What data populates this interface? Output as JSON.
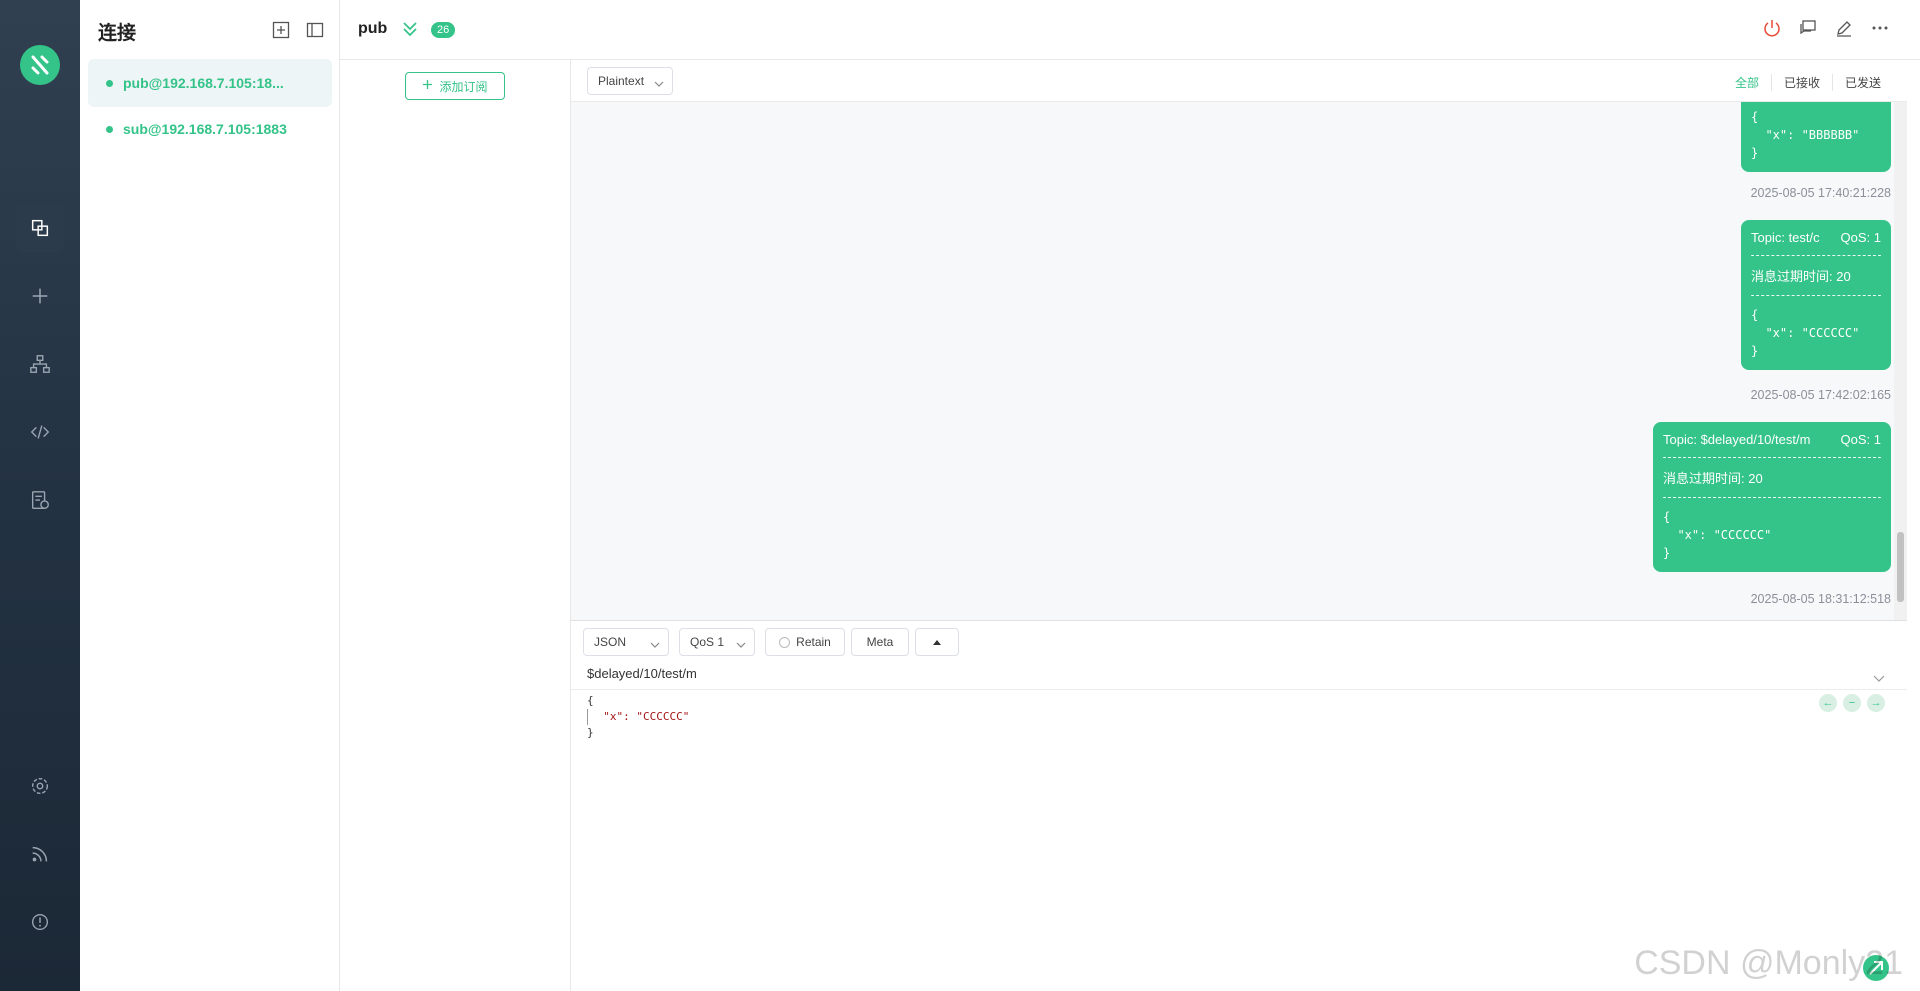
{
  "sidebar": {
    "icons": [
      "logo-icon",
      "connections-icon",
      "new-connection-icon",
      "topology-icon",
      "script-icon",
      "log-icon",
      "settings-icon",
      "feed-icon",
      "about-icon"
    ]
  },
  "connections": {
    "title": "连接",
    "items": [
      {
        "label": "pub@192.168.7.105:18...",
        "active": true
      },
      {
        "label": "sub@192.168.7.105:1883",
        "active": false
      }
    ]
  },
  "header": {
    "connection_name": "pub",
    "badge": "26"
  },
  "subscriptions": {
    "add_label": "添加订阅"
  },
  "message_toolbar": {
    "format": "Plaintext",
    "filters": [
      "全部",
      "已接收",
      "已发送"
    ]
  },
  "messages": [
    {
      "payload": "{\n  \"x\": \"BBBBBB\"\n}",
      "timestamp": "2025-08-05 17:40:21:228"
    },
    {
      "topic": "Topic: test/c",
      "qos": "QoS: 1",
      "expiry": "消息过期时间: 20",
      "payload": "{\n  \"x\": \"CCCCCC\"\n}",
      "timestamp": "2025-08-05 17:42:02:165"
    },
    {
      "topic": "Topic: $delayed/10/test/m",
      "qos": "QoS: 1",
      "expiry": "消息过期时间: 20",
      "payload": "{\n  \"x\": \"CCCCCC\"\n}",
      "timestamp": "2025-08-05 18:31:12:518"
    }
  ],
  "publish": {
    "format": "JSON",
    "qos": "QoS 1",
    "retain": "Retain",
    "meta": "Meta",
    "topic": "$delayed/10/test/m",
    "editor_lines": [
      "{",
      "  \"x\": \"CCCCCC\"",
      "}"
    ]
  },
  "watermark": "CSDN @Monly21",
  "colors": {
    "accent": "#34c388",
    "rail": "#233242"
  }
}
